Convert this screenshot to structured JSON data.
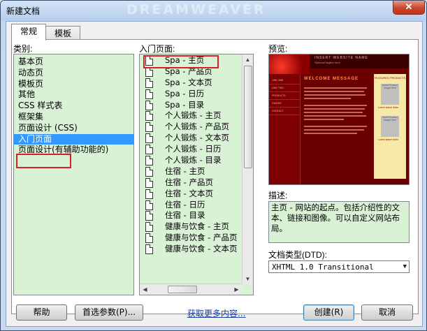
{
  "window": {
    "title": "新建文档",
    "title_watermark": "DREAMWEAVER",
    "close_glyph": "✕"
  },
  "tabs": [
    {
      "label": "常规",
      "active": true
    },
    {
      "label": "模板",
      "active": false
    }
  ],
  "categories": {
    "label": "类别:",
    "items": [
      "基本页",
      "动态页",
      "模板页",
      "其他",
      "CSS 样式表",
      "框架集",
      "页面设计 (CSS)",
      "入门页面",
      "页面设计(有辅助功能的)"
    ],
    "selected_index": 7
  },
  "pages": {
    "label": "入门页面:",
    "items": [
      "Spa - 主页",
      "Spa - 产品页",
      "Spa - 文本页",
      "Spa - 日历",
      "Spa - 目录",
      "个人锻炼 - 主页",
      "个人锻炼 - 产品页",
      "个人锻炼 - 文本页",
      "个人锻炼 - 日历",
      "个人锻炼 - 目录",
      "住宿 - 主页",
      "住宿 - 产品页",
      "住宿 - 文本页",
      "住宿 - 日历",
      "住宿 - 目录",
      "健康与饮食 - 主页",
      "健康与饮食 - 产品页",
      "健康与饮食 - 文本页"
    ]
  },
  "preview": {
    "label": "预览:",
    "thumb_header": "INSERT WEBSITE NAME",
    "thumb_subheader": "Optional tagline here",
    "thumb_heading": "WELCOME MESSAGE",
    "thumb_nav": [
      "LINK ONE",
      "LINK TWO",
      "PRODUCTS",
      "GUIDES",
      "CONTACT"
    ],
    "thumb_side_title": "FEATURED PRODUCTS",
    "thumb_side_items": [
      "Lorem ipsum dolor",
      "Lorem ipsum dolor"
    ],
    "thumb_image_label": "Insert Product Image Here"
  },
  "description": {
    "label": "描述:",
    "text": "主页 - 网站的起点。包括介绍性的文本、链接和图像。可以自定义网站布局。"
  },
  "doctype": {
    "label": "文档类型(DTD):",
    "value": "XHTML 1.0 Transitional"
  },
  "buttons": {
    "help": "帮助",
    "preferences": "首选参数(P)...",
    "get_more": "获取更多内容...",
    "create": "创建(R)",
    "cancel": "取消"
  },
  "colors": {
    "list_bg": "#d9f2d6",
    "selection": "#3399ff",
    "highlight": "#d8202a",
    "preview_bg": "#6b0000"
  }
}
